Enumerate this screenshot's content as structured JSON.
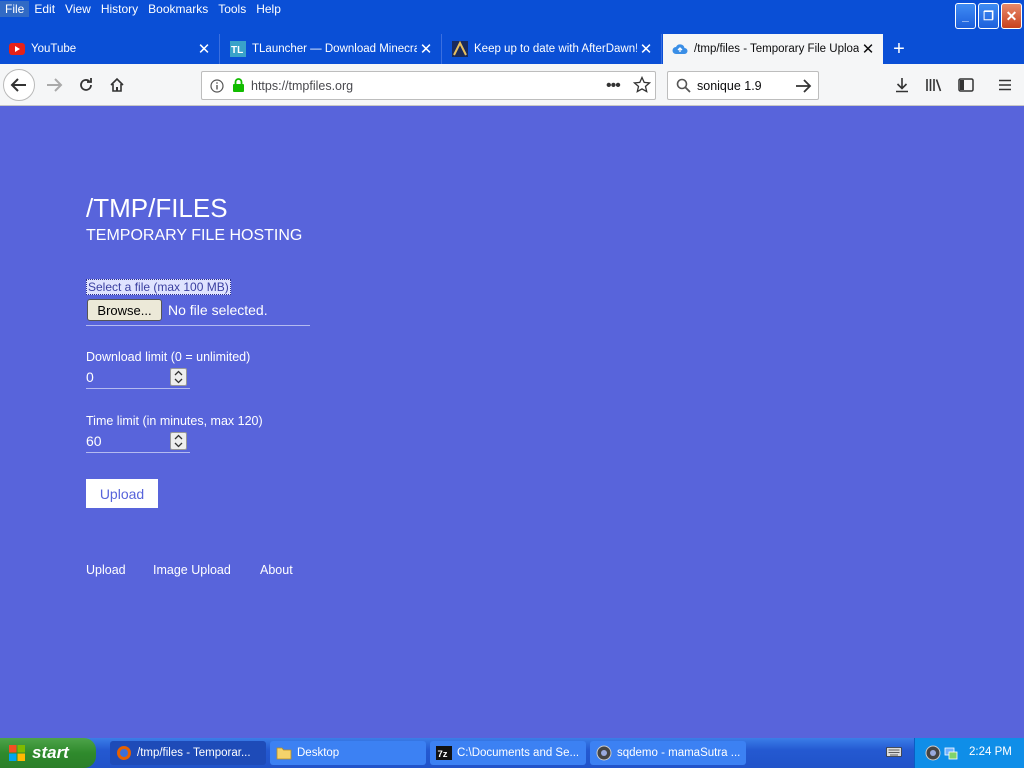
{
  "window": {
    "menus": [
      "File",
      "Edit",
      "View",
      "History",
      "Bookmarks",
      "Tools",
      "Help"
    ]
  },
  "tabs": [
    {
      "label": "YouTube",
      "icon": "youtube-icon"
    },
    {
      "label": "TLauncher — Download Minecraft",
      "icon": "tlauncher-icon"
    },
    {
      "label": "Keep up to date with AfterDawn!",
      "icon": "afterdawn-icon"
    },
    {
      "label": "/tmp/files - Temporary File Upload",
      "icon": "cloud-upload-icon"
    }
  ],
  "navbar": {
    "url": "https://tmpfiles.org",
    "search_value": "sonique 1.9"
  },
  "page": {
    "title": "/TMP/FILES",
    "subtitle": "TEMPORARY FILE HOSTING",
    "file_label": "Select a file (max 100 MB)",
    "browse_label": "Browse...",
    "file_status": "No file selected.",
    "download_limit_label": "Download limit (0 = unlimited)",
    "download_limit_value": "0",
    "time_limit_label": "Time limit (in minutes, max 120)",
    "time_limit_value": "60",
    "upload_button": "Upload",
    "footer_links": [
      "Upload",
      "Image Upload",
      "About"
    ]
  },
  "taskbar": {
    "start_label": "start",
    "tasks": [
      {
        "label": "/tmp/files - Temporar...",
        "icon": "firefox-icon"
      },
      {
        "label": "Desktop",
        "icon": "folder-icon"
      },
      {
        "label": "C:\\Documents and Se...",
        "icon": "7zip-icon"
      },
      {
        "label": "sqdemo - mamaSutra ...",
        "icon": "sonique-icon"
      }
    ],
    "clock": "2:24 PM"
  },
  "colors": {
    "page_background": "#5864db",
    "titlebar_blue": "#0a4fd6",
    "taskbar_blue": "#2459d1",
    "start_green": "#2f8a2c"
  }
}
